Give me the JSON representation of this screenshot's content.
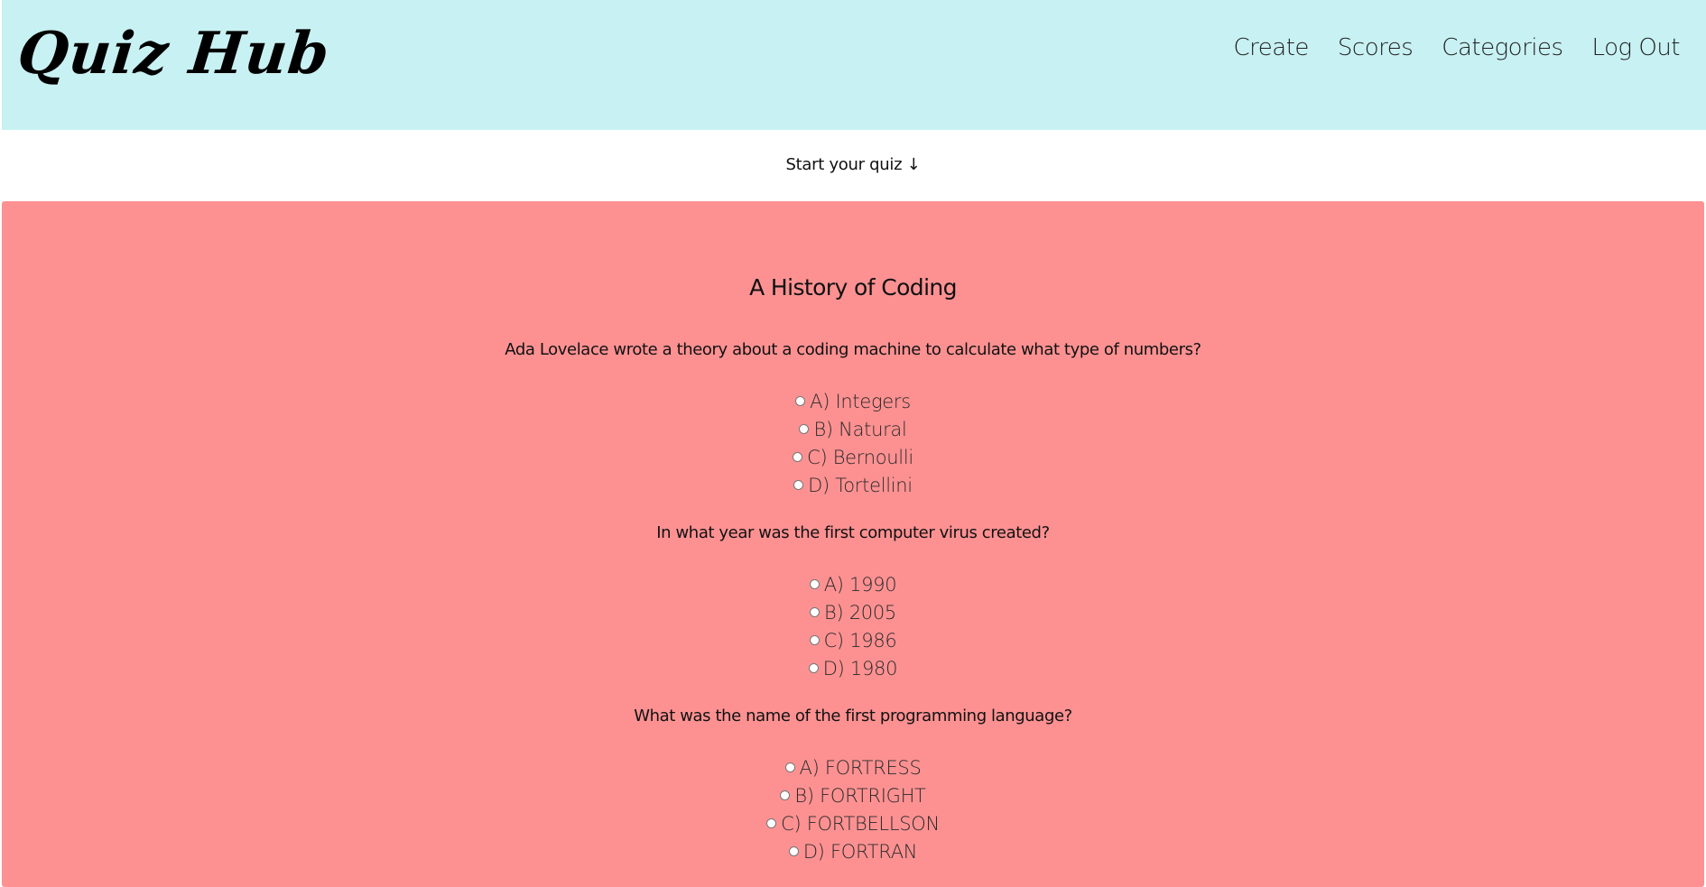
{
  "header": {
    "logo": "Quiz Hub",
    "nav": [
      "Create",
      "Scores",
      "Categories",
      "Log Out"
    ]
  },
  "start_prompt": "Start your quiz ↓",
  "quiz": {
    "title": "A History of Coding",
    "questions": [
      {
        "text": "Ada Lovelace wrote a theory about a coding machine to calculate what type of numbers?",
        "options": [
          "A) Integers",
          "B) Natural",
          "C) Bernoulli",
          "D) Tortellini"
        ]
      },
      {
        "text": "In what year was the first computer virus created?",
        "options": [
          "A) 1990",
          "B) 2005",
          "C) 1986",
          "D) 1980"
        ]
      },
      {
        "text": "What was the name of the first programming language?",
        "options": [
          "A) FORTRESS",
          "B) FORTRIGHT",
          "C) FORTBELLSON",
          "D) FORTRAN"
        ]
      }
    ]
  },
  "colors": {
    "header_bg": "#c8f1f3",
    "quiz_bg": "#fd9192"
  }
}
